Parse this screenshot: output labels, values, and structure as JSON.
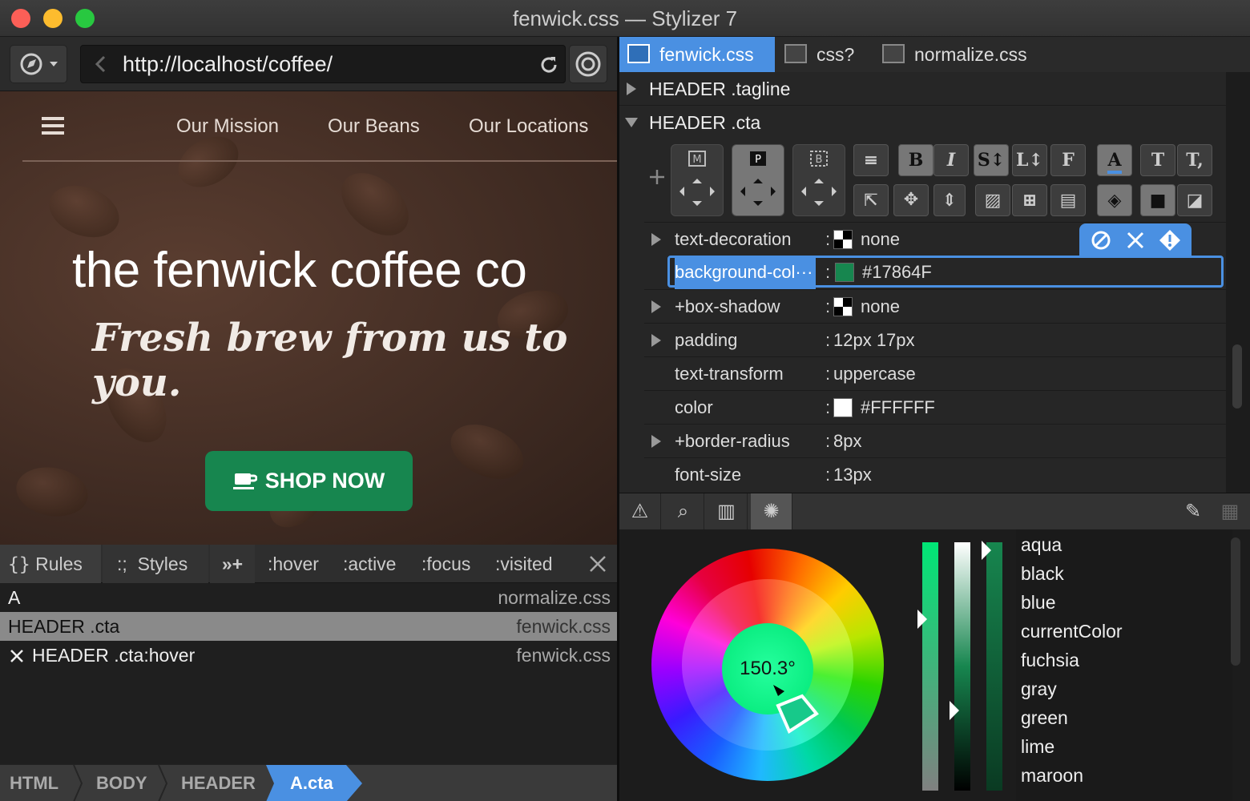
{
  "window": {
    "title": "fenwick.css — Stylizer 7"
  },
  "browser": {
    "url": "http://localhost/coffee/"
  },
  "site": {
    "nav": [
      "Our Mission",
      "Our Beans",
      "Our Locations"
    ],
    "hero_title": "the fenwick coffee co",
    "tagline": "Fresh brew from us to you.",
    "cta": "SHOP NOW"
  },
  "rules_panel": {
    "tabs": {
      "rules": "Rules",
      "styles": "Styles",
      "hover": ":hover",
      "active": ":active",
      "focus": ":focus",
      "visited": ":visited"
    },
    "rows": [
      {
        "selector": "A",
        "file": "normalize.css"
      },
      {
        "selector": "HEADER .cta",
        "file": "fenwick.css"
      },
      {
        "selector": "HEADER .cta:hover",
        "file": "fenwick.css"
      }
    ]
  },
  "breadcrumb": [
    "HTML",
    "BODY",
    "HEADER",
    "A.cta"
  ],
  "files": [
    "fenwick.css",
    "css?",
    "normalize.css"
  ],
  "selectors": [
    "HEADER .tagline",
    "HEADER .cta"
  ],
  "properties": [
    {
      "name": "text-decoration",
      "value": "none",
      "swatch": "checker",
      "expandable": true
    },
    {
      "name": "background-col···",
      "value": "#17864F",
      "swatch": "#17864F",
      "expandable": false,
      "selected": true
    },
    {
      "name": "+box-shadow",
      "value": "none",
      "swatch": "checker",
      "expandable": true
    },
    {
      "name": "padding",
      "value": "12px 17px",
      "expandable": true
    },
    {
      "name": "text-transform",
      "value": "uppercase",
      "expandable": false
    },
    {
      "name": "color",
      "value": "#FFFFFF",
      "swatch": "#FFFFFF",
      "expandable": false
    },
    {
      "name": "+border-radius",
      "value": "8px",
      "expandable": true
    },
    {
      "name": "font-size",
      "value": "13px",
      "expandable": false
    }
  ],
  "color_picker": {
    "hue": "150.3°",
    "names": [
      "aqua",
      "black",
      "blue",
      "currentColor",
      "fuchsia",
      "gray",
      "green",
      "lime",
      "maroon"
    ]
  },
  "colors": {
    "accent": "#4a90e2",
    "cta": "#17864F"
  }
}
